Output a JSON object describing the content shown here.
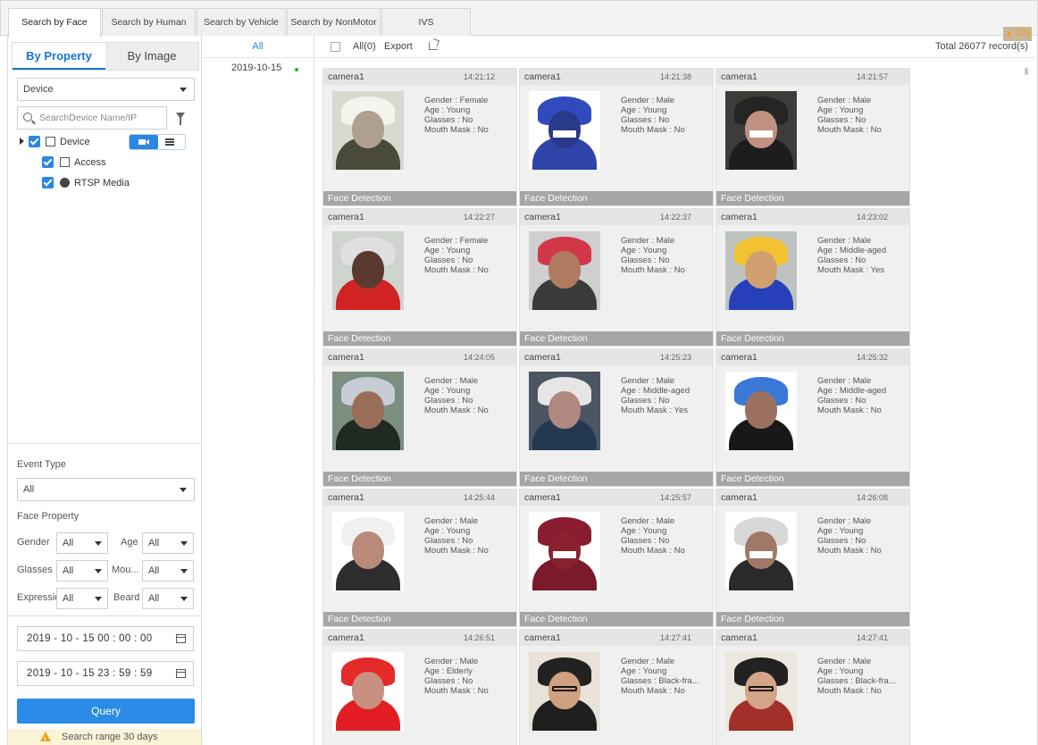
{
  "tabs": [
    {
      "label": "Search by Face",
      "active": true
    },
    {
      "label": "Search by Human",
      "active": false
    },
    {
      "label": "Search by Vehicle",
      "active": false
    },
    {
      "label": "Search by NonMotor",
      "active": false
    },
    {
      "label": "IVS",
      "active": false
    }
  ],
  "alarm_count": "128",
  "left": {
    "subtabs": [
      "By Property",
      "By Image"
    ],
    "device_select": "Device",
    "search_placeholder": "SearchDevice Name/IP",
    "tree": [
      "Device",
      "Access",
      "RTSP Media"
    ],
    "event_type_label": "Event Type",
    "event_type_value": "All",
    "face_property_label": "Face Property",
    "props": {
      "gender_label": "Gender",
      "gender_value": "All",
      "age_label": "Age",
      "age_value": "All",
      "glasses_label": "Glasses",
      "glasses_value": "All",
      "mouth_label": "Mou...",
      "mouth_value": "All",
      "expression_label": "Expressic",
      "expression_value": "All",
      "beard_label": "Beard",
      "beard_value": "All"
    },
    "start_time": "2019 - 10 - 15  00 : 00 : 00",
    "end_time": "2019 - 10 - 15  23 : 59 : 59",
    "query_label": "Query",
    "warning": "Search range 30 days"
  },
  "datecol": {
    "all": "All",
    "date": "2019-10-15"
  },
  "results": {
    "select_all": "All(0)",
    "export": "Export",
    "total": "Total 26077 record(s)",
    "footer_label": "Face Detection",
    "cards": [
      {
        "camera": "camera1",
        "time": "14:21:12",
        "gender": "Gender : Female",
        "age": "Age : Young",
        "glasses": "Glasses : No",
        "mask": "Mouth Mask : No"
      },
      {
        "camera": "camera1",
        "time": "14:21:38",
        "gender": "Gender : Male",
        "age": "Age : Young",
        "glasses": "Glasses : No",
        "mask": "Mouth Mask : No"
      },
      {
        "camera": "camera1",
        "time": "14:21:57",
        "gender": "Gender : Male",
        "age": "Age : Young",
        "glasses": "Glasses : No",
        "mask": "Mouth Mask : No"
      },
      {
        "camera": "camera1",
        "time": "14:22:27",
        "gender": "Gender : Female",
        "age": "Age : Young",
        "glasses": "Glasses : No",
        "mask": "Mouth Mask : No"
      },
      {
        "camera": "camera1",
        "time": "14:22:37",
        "gender": "Gender : Male",
        "age": "Age : Young",
        "glasses": "Glasses : No",
        "mask": "Mouth Mask : No"
      },
      {
        "camera": "camera1",
        "time": "14:23:02",
        "gender": "Gender : Male",
        "age": "Age : Middle-aged",
        "glasses": "Glasses : No",
        "mask": "Mouth Mask : Yes"
      },
      {
        "camera": "camera1",
        "time": "14:24:05",
        "gender": "Gender : Male",
        "age": "Age : Young",
        "glasses": "Glasses : No",
        "mask": "Mouth Mask : No"
      },
      {
        "camera": "camera1",
        "time": "14:25:23",
        "gender": "Gender : Male",
        "age": "Age : Middle-aged",
        "glasses": "Glasses : No",
        "mask": "Mouth Mask : Yes"
      },
      {
        "camera": "camera1",
        "time": "14:25:32",
        "gender": "Gender : Male",
        "age": "Age : Middle-aged",
        "glasses": "Glasses : No",
        "mask": "Mouth Mask : No"
      },
      {
        "camera": "camera1",
        "time": "14:25:44",
        "gender": "Gender : Male",
        "age": "Age : Young",
        "glasses": "Glasses : No",
        "mask": "Mouth Mask : No"
      },
      {
        "camera": "camera1",
        "time": "14:25:57",
        "gender": "Gender : Male",
        "age": "Age : Young",
        "glasses": "Glasses : No",
        "mask": "Mouth Mask : No"
      },
      {
        "camera": "camera1",
        "time": "14:26:08",
        "gender": "Gender : Male",
        "age": "Age : Young",
        "glasses": "Glasses : No",
        "mask": "Mouth Mask : No"
      },
      {
        "camera": "camera1",
        "time": "14:26:51",
        "gender": "Gender : Male",
        "age": "Age : Elderly",
        "glasses": "Glasses : No",
        "mask": "Mouth Mask : No"
      },
      {
        "camera": "camera1",
        "time": "14:27:41",
        "gender": "Gender : Male",
        "age": "Age : Young",
        "glasses": "Glasses : Black-fra...",
        "mask": "Mouth Mask : No"
      },
      {
        "camera": "camera1",
        "time": "14:27:41",
        "gender": "Gender : Male",
        "age": "Age : Young",
        "glasses": "Glasses : Black-fra...",
        "mask": "Mouth Mask : No"
      }
    ]
  }
}
